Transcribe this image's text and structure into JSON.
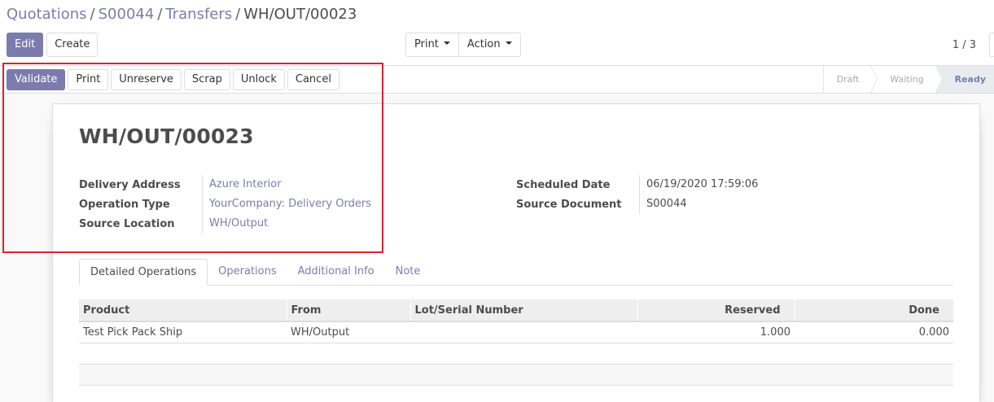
{
  "breadcrumb": {
    "items": [
      "Quotations",
      "S00044",
      "Transfers"
    ],
    "current": "WH/OUT/00023",
    "separator": "/"
  },
  "control_panel": {
    "edit_label": "Edit",
    "create_label": "Create",
    "print_label": "Print",
    "action_label": "Action",
    "pager": "1 / 3"
  },
  "statusbar": {
    "buttons": [
      "Validate",
      "Print",
      "Unreserve",
      "Scrap",
      "Unlock",
      "Cancel"
    ],
    "stages": [
      "Draft",
      "Waiting",
      "Ready"
    ],
    "active_stage": "Ready"
  },
  "record": {
    "title": "WH/OUT/00023",
    "left_fields": [
      {
        "label": "Delivery Address",
        "value": "Azure Interior"
      },
      {
        "label": "Operation Type",
        "value": "YourCompany: Delivery Orders"
      },
      {
        "label": "Source Location",
        "value": "WH/Output"
      }
    ],
    "right_fields": [
      {
        "label": "Scheduled Date",
        "value": "06/19/2020 17:59:06"
      },
      {
        "label": "Source Document",
        "value": "S00044"
      }
    ]
  },
  "notebook": {
    "tabs": [
      "Detailed Operations",
      "Operations",
      "Additional Info",
      "Note"
    ],
    "active_tab": "Detailed Operations"
  },
  "operations_table": {
    "columns": [
      "Product",
      "From",
      "Lot/Serial Number",
      "Reserved",
      "Done"
    ],
    "rows": [
      [
        "Test Pick Pack Ship",
        "WH/Output",
        "",
        "1.000",
        "0.000"
      ]
    ]
  },
  "colors": {
    "brand": "#7c7bad",
    "highlight": "#d9232d"
  }
}
